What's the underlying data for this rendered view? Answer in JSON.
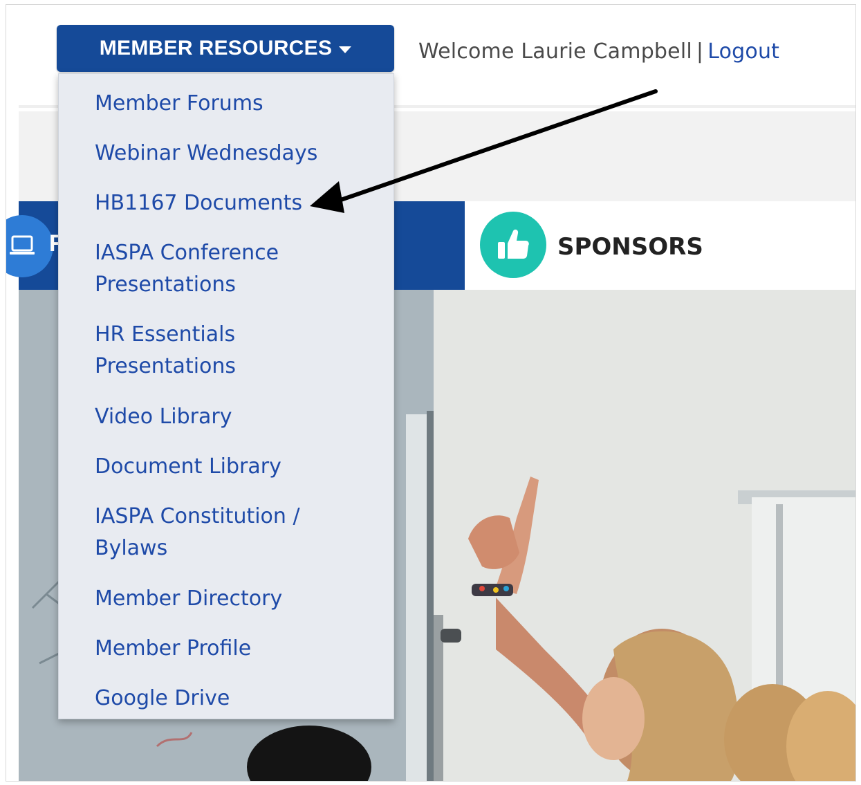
{
  "header": {
    "button_label": "MEMBER RESOURCES",
    "welcome_text": "Welcome Laurie Campbell",
    "separator": "|",
    "logout_label": "Logout"
  },
  "tiles": {
    "left_tile_letter": "R",
    "sponsors_label": "SPONSORS"
  },
  "menu": {
    "items": [
      {
        "line1": "Member Forums",
        "line2": ""
      },
      {
        "line1": "Webinar Wednesdays",
        "line2": ""
      },
      {
        "line1": "HB1167 Documents",
        "line2": ""
      },
      {
        "line1": "IASPA Conference",
        "line2": "Presentations"
      },
      {
        "line1": "HR Essentials",
        "line2": "Presentations"
      },
      {
        "line1": "Video Library",
        "line2": ""
      },
      {
        "line1": "Document Library",
        "line2": ""
      },
      {
        "line1": "IASPA Constitution /",
        "line2": "Bylaws"
      },
      {
        "line1": "Member Directory",
        "line2": ""
      },
      {
        "line1": "Member Profile",
        "line2": ""
      },
      {
        "line1": "Google Drive",
        "line2": ""
      }
    ]
  },
  "colors": {
    "brand_blue": "#154a98",
    "link_blue": "#1e4aa8",
    "sponsor_teal": "#1ec3b0",
    "menu_bg": "#e8ebf1"
  },
  "icons": {
    "dropdown": "caret-down-icon",
    "sponsors": "thumbs-up-icon",
    "left_tile": "laptop-icon",
    "annotation": "arrow-icon"
  }
}
